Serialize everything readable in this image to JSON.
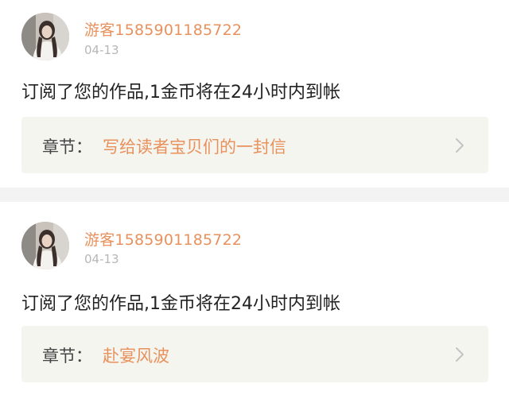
{
  "colors": {
    "accent": "#e8915c",
    "muted": "#b7b7b7",
    "text": "#222222",
    "chapter_bg": "#f5f5f0",
    "divider_bg": "#f3f3f3"
  },
  "notifications": [
    {
      "username": "游客1585901185722",
      "date": "04-13",
      "message": "订阅了您的作品,1金币将在24小时内到帐",
      "chapter_label": "章节：",
      "chapter_title": "写给读者宝贝们的一封信",
      "avatar_icon": "user-avatar",
      "arrow_icon": "chevron-right-icon"
    },
    {
      "username": "游客1585901185722",
      "date": "04-13",
      "message": "订阅了您的作品,1金币将在24小时内到帐",
      "chapter_label": "章节：",
      "chapter_title": "赴宴风波",
      "avatar_icon": "user-avatar",
      "arrow_icon": "chevron-right-icon"
    }
  ]
}
